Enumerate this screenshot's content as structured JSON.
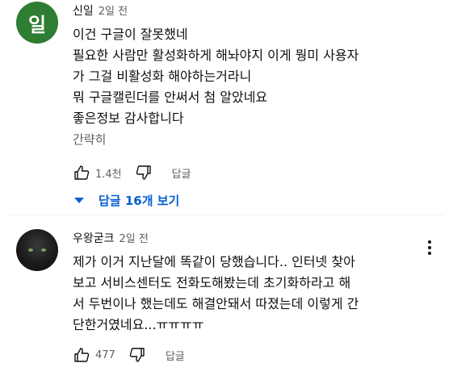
{
  "comments": [
    {
      "avatar_letter": "일",
      "author": "신일",
      "time": "2일 전",
      "lines": [
        "이건 구글이 잘못했네",
        "필요한 사람만 활성화하게 해놔야지 이게 뭥미 사용자",
        "가 그걸 비활성화 해야하는거라니",
        "뭐 구글캘린더를 안써서 첨 알았네요",
        "좋은정보 감사합니다"
      ],
      "read_more": "간략히",
      "likes": "1.4천",
      "reply_label": "답글",
      "replies_toggle": "답글 16개 보기"
    },
    {
      "author": "우왕굳크",
      "time": "2일 전",
      "lines": [
        "제가 이거 지난달에 똑같이 당했습니다.. 인터넷 찾아",
        "보고 서비스센터도 전화도해봤는데 초기화하라고 해",
        "서 두번이나 했는데도 해결안돼서 따졌는데 이렇게 간",
        "단한거였네요...ㅠㅠㅠㅠ"
      ],
      "likes": "477",
      "reply_label": "답글"
    }
  ],
  "colors": {
    "avatar_green": "#2e7d32",
    "link_blue": "#065fd4",
    "secondary_text": "#606060"
  }
}
